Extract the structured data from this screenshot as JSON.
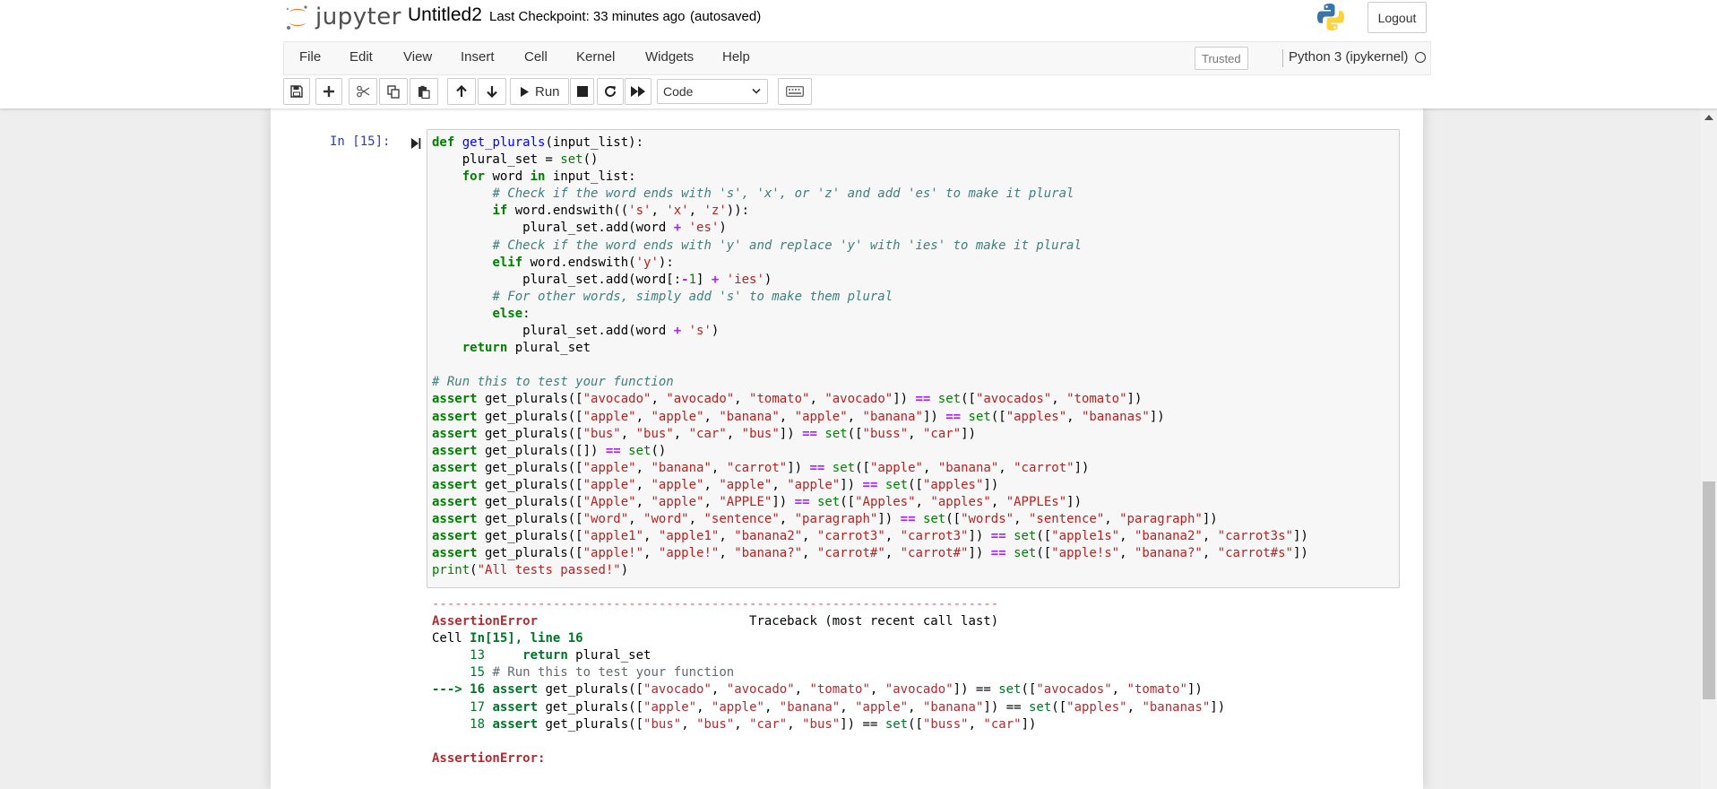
{
  "header": {
    "logo_text": "jupyter",
    "notebook_name": "Untitled2",
    "checkpoint": "Last Checkpoint: 33 minutes ago",
    "autosaved": "(autosaved)",
    "logout_label": "Logout"
  },
  "menubar": {
    "items": [
      "File",
      "Edit",
      "View",
      "Insert",
      "Cell",
      "Kernel",
      "Widgets",
      "Help"
    ],
    "trusted": "Trusted",
    "kernel_name": "Python 3 (ipykernel)"
  },
  "toolbar": {
    "run_label": "Run",
    "cell_type": "Code",
    "icons": [
      "save-icon",
      "plus-icon",
      "cut-icon",
      "copy-icon",
      "paste-icon",
      "arrow-up-icon",
      "arrow-down-icon",
      "play-icon",
      "stop-icon",
      "restart-icon",
      "fast-forward-icon",
      "keyboard-icon"
    ]
  },
  "cell": {
    "prompt": "In [15]:",
    "code_lines": [
      "def get_plurals(input_list):",
      "    plural_set = set()",
      "    for word in input_list:",
      "        # Check if the word ends with 's', 'x', or 'z' and add 'es' to make it plural",
      "        if word.endswith(('s', 'x', 'z')):",
      "            plural_set.add(word + 'es')",
      "        # Check if the word ends with 'y' and replace 'y' with 'ies' to make it plural",
      "        elif word.endswith('y'):",
      "            plural_set.add(word[:-1] + 'ies')",
      "        # For other words, simply add 's' to make them plural",
      "        else:",
      "            plural_set.add(word + 's')",
      "    return plural_set",
      "",
      "# Run this to test your function",
      "assert get_plurals([\"avocado\", \"avocado\", \"tomato\", \"avocado\"]) == set([\"avocados\", \"tomato\"])",
      "assert get_plurals([\"apple\", \"apple\", \"banana\", \"apple\", \"banana\"]) == set([\"apples\", \"bananas\"])",
      "assert get_plurals([\"bus\", \"bus\", \"car\", \"bus\"]) == set([\"buss\", \"car\"])",
      "assert get_plurals([]) == set()",
      "assert get_plurals([\"apple\", \"banana\", \"carrot\"]) == set([\"apple\", \"banana\", \"carrot\"])",
      "assert get_plurals([\"apple\", \"apple\", \"apple\", \"apple\"]) == set([\"apples\"])",
      "assert get_plurals([\"Apple\", \"apple\", \"APPLE\"]) == set([\"Apples\", \"apples\", \"APPLEs\"])",
      "assert get_plurals([\"word\", \"word\", \"sentence\", \"paragraph\"]) == set([\"words\", \"sentence\", \"paragraph\"])",
      "assert get_plurals([\"apple1\", \"apple1\", \"banana2\", \"carrot3\", \"carrot3\"]) == set([\"apple1s\", \"banana2\", \"carrot3s\"])",
      "assert get_plurals([\"apple!\", \"apple!\", \"banana?\", \"carrot#\", \"carrot#\"]) == set([\"apple!s\", \"banana?\", \"carrot#s\"])",
      "print(\"All tests passed!\")"
    ],
    "output_lines": [
      "---------------------------------------------------------------------------",
      "AssertionError                            Traceback (most recent call last)",
      "Cell In[15], line 16",
      "     13     return plural_set",
      "     15 # Run this to test your function",
      "---> 16 assert get_plurals([\"avocado\", \"avocado\", \"tomato\", \"avocado\"]) == set([\"avocados\", \"tomato\"])",
      "     17 assert get_plurals([\"apple\", \"apple\", \"banana\", \"apple\", \"banana\"]) == set([\"apples\", \"bananas\"])",
      "     18 assert get_plurals([\"bus\", \"bus\", \"car\", \"bus\"]) == set([\"buss\", \"car\"])",
      "",
      "AssertionError: "
    ]
  },
  "colors": {
    "keyword": "#008000",
    "string": "#ba2121",
    "comment": "#408080",
    "operator": "#aa22ff",
    "prompt": "#303f9f",
    "error_red": "#b22b31"
  }
}
